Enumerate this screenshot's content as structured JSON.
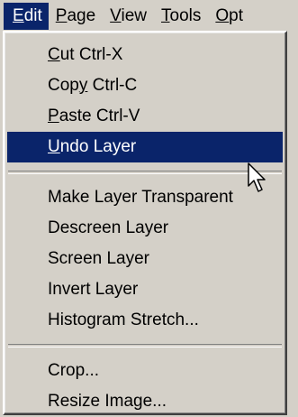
{
  "menubar": {
    "items": [
      {
        "mnemonic": "E",
        "rest": "dit",
        "active": true
      },
      {
        "mnemonic": "P",
        "rest": "age"
      },
      {
        "mnemonic": "V",
        "rest": "iew"
      },
      {
        "mnemonic": "T",
        "rest": "ools"
      },
      {
        "mnemonic": "O",
        "rest": "pt"
      }
    ]
  },
  "edit_menu": {
    "items": [
      {
        "pre": "",
        "mnemonic": "C",
        "post": "ut Ctrl-X"
      },
      {
        "pre": "Cop",
        "mnemonic": "y",
        "post": " Ctrl-C"
      },
      {
        "pre": "",
        "mnemonic": "P",
        "post": "aste Ctrl-V"
      },
      {
        "pre": "",
        "mnemonic": "U",
        "post": "ndo Layer",
        "highlighted": true
      },
      {
        "separator": true
      },
      {
        "label": "Make Layer Transparent"
      },
      {
        "label": "Descreen Layer"
      },
      {
        "label": "Screen Layer"
      },
      {
        "label": "Invert Layer"
      },
      {
        "label": "Histogram Stretch..."
      },
      {
        "separator": true
      },
      {
        "label": "Crop..."
      },
      {
        "label": "Resize Image..."
      }
    ]
  },
  "colors": {
    "highlight": "#0a246a",
    "menu_bg": "#d4d0c8"
  },
  "cursor": {
    "icon": "arrow-pointer-icon"
  }
}
